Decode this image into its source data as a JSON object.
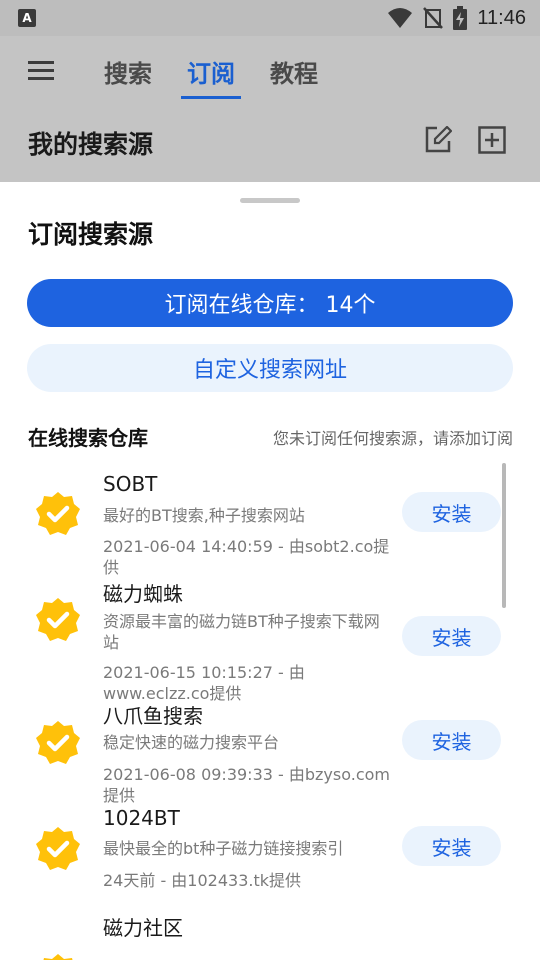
{
  "status_bar": {
    "time": "11:46",
    "app_icon_letter": "A"
  },
  "header": {
    "tabs": [
      {
        "label": "搜索",
        "active": false
      },
      {
        "label": "订阅",
        "active": true
      },
      {
        "label": "教程",
        "active": false
      }
    ],
    "section_title": "我的搜索源",
    "accent_color": "#1a5fd0"
  },
  "sheet": {
    "title": "订阅搜索源",
    "online_repo_button": "订阅在线仓库：  14个",
    "custom_url_button": "自定义搜索网址",
    "repo_section_title": "在线搜索仓库",
    "repo_hint": "您未订阅任何搜索源，请添加订阅",
    "install_label": "安装",
    "items": [
      {
        "name": "SOBT",
        "desc": "最好的BT搜索,种子搜索网站",
        "meta": "2021-06-04 14:40:59 - 由sobt2.co提供"
      },
      {
        "name": "磁力蜘蛛",
        "desc": "资源最丰富的磁力链BT种子搜索下载网站",
        "meta": "2021-06-15 10:15:27 - 由www.eclzz.co提供"
      },
      {
        "name": "八爪鱼搜索",
        "desc": "稳定快速的磁力搜索平台",
        "meta": "2021-06-08 09:39:33 - 由bzyso.com提供"
      },
      {
        "name": "1024BT",
        "desc": "最快最全的bt种子磁力链接搜索引",
        "meta": "24天前 - 由102433.tk提供"
      },
      {
        "name": "磁力社区"
      }
    ]
  }
}
